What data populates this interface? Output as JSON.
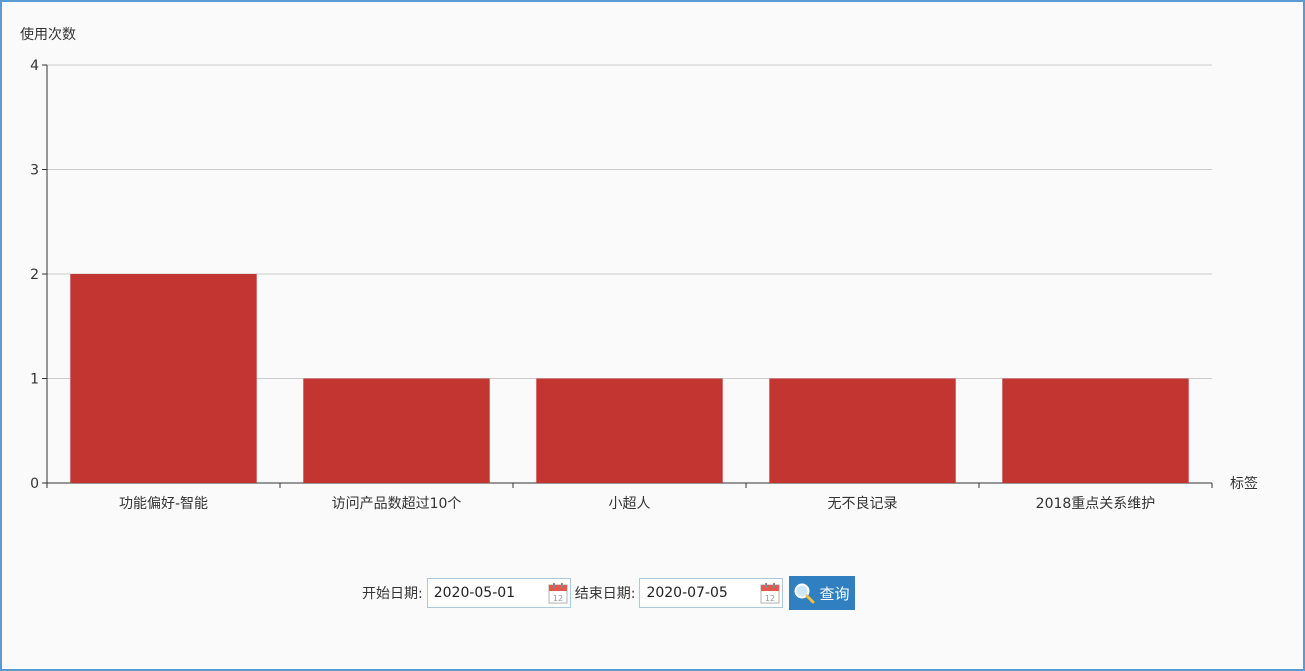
{
  "chart_data": {
    "type": "bar",
    "ylabel": "使用次数",
    "xlabel": "标签",
    "categories": [
      "功能偏好-智能",
      "访问产品数超过10个",
      "小超人",
      "无不良记录",
      "2018重点关系维护"
    ],
    "values": [
      2,
      1,
      1,
      1,
      1
    ],
    "ylim": [
      0,
      4
    ],
    "yticks": [
      0,
      1,
      2,
      3,
      4
    ],
    "grid": true,
    "bar_color": "#c23531"
  },
  "filter": {
    "start_label": "开始日期:",
    "start_value": "2020-05-01",
    "end_label": "结束日期:",
    "end_value": "2020-07-05",
    "query_label": "查询",
    "button_color": "#2f7fc1"
  }
}
